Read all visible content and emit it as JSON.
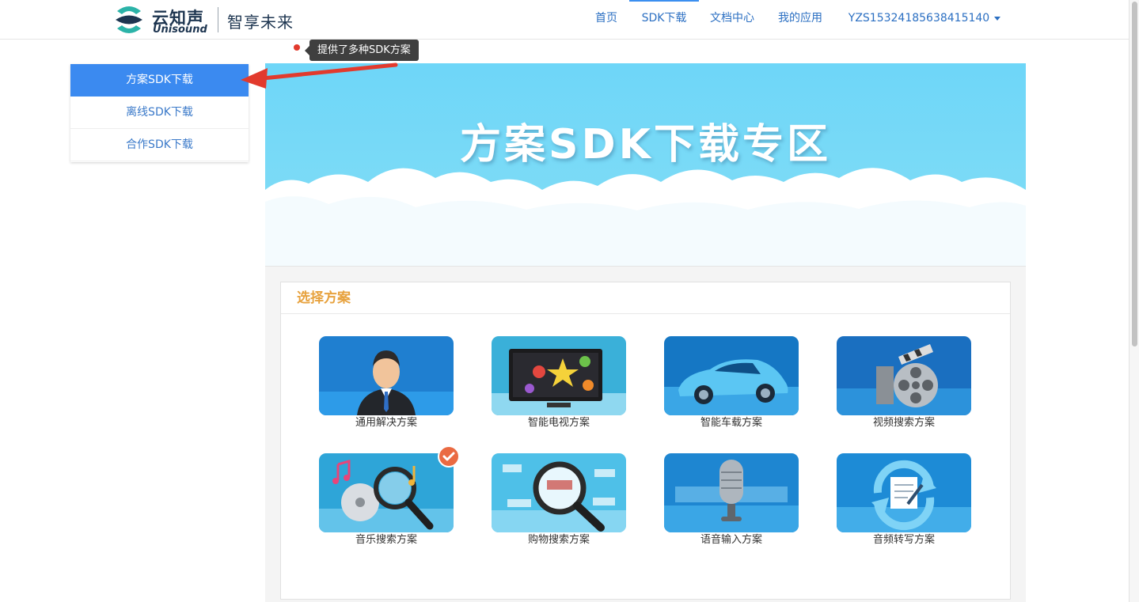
{
  "header": {
    "logo_cn": "云知声",
    "logo_en": "Unisound",
    "slogan": "智享未来",
    "nav": [
      {
        "label": "首页"
      },
      {
        "label": "SDK下载",
        "active": true
      },
      {
        "label": "文档中心"
      },
      {
        "label": "我的应用"
      },
      {
        "label": "YZS15324185638415140",
        "dropdown": true
      }
    ]
  },
  "tooltip": {
    "text": "提供了多种SDK方案"
  },
  "sidebar": {
    "items": [
      {
        "label": "方案SDK下载",
        "active": true
      },
      {
        "label": "离线SDK下载"
      },
      {
        "label": "合作SDK下载"
      }
    ]
  },
  "banner": {
    "title": "方案SDK下载专区"
  },
  "panel": {
    "title": "选择方案",
    "solutions": [
      {
        "label": "通用解决方案",
        "icon": "businessman-icon"
      },
      {
        "label": "智能电视方案",
        "icon": "tv-icon"
      },
      {
        "label": "智能车载方案",
        "icon": "car-icon"
      },
      {
        "label": "视频搜索方案",
        "icon": "film-reel-icon"
      },
      {
        "label": "音乐搜索方案",
        "icon": "music-search-icon",
        "selected": true
      },
      {
        "label": "购物搜索方案",
        "icon": "shopping-search-icon"
      },
      {
        "label": "语音输入方案",
        "icon": "microphone-icon"
      },
      {
        "label": "音频转写方案",
        "icon": "transcribe-icon"
      }
    ]
  },
  "colors": {
    "nav_text": "#2b6fc2",
    "sidebar_active": "#3b8af0",
    "panel_title": "#e7a23e",
    "banner_sky": "#6fd6f7",
    "check_badge": "#ea6a42",
    "annotation_red": "#e23a2d"
  }
}
